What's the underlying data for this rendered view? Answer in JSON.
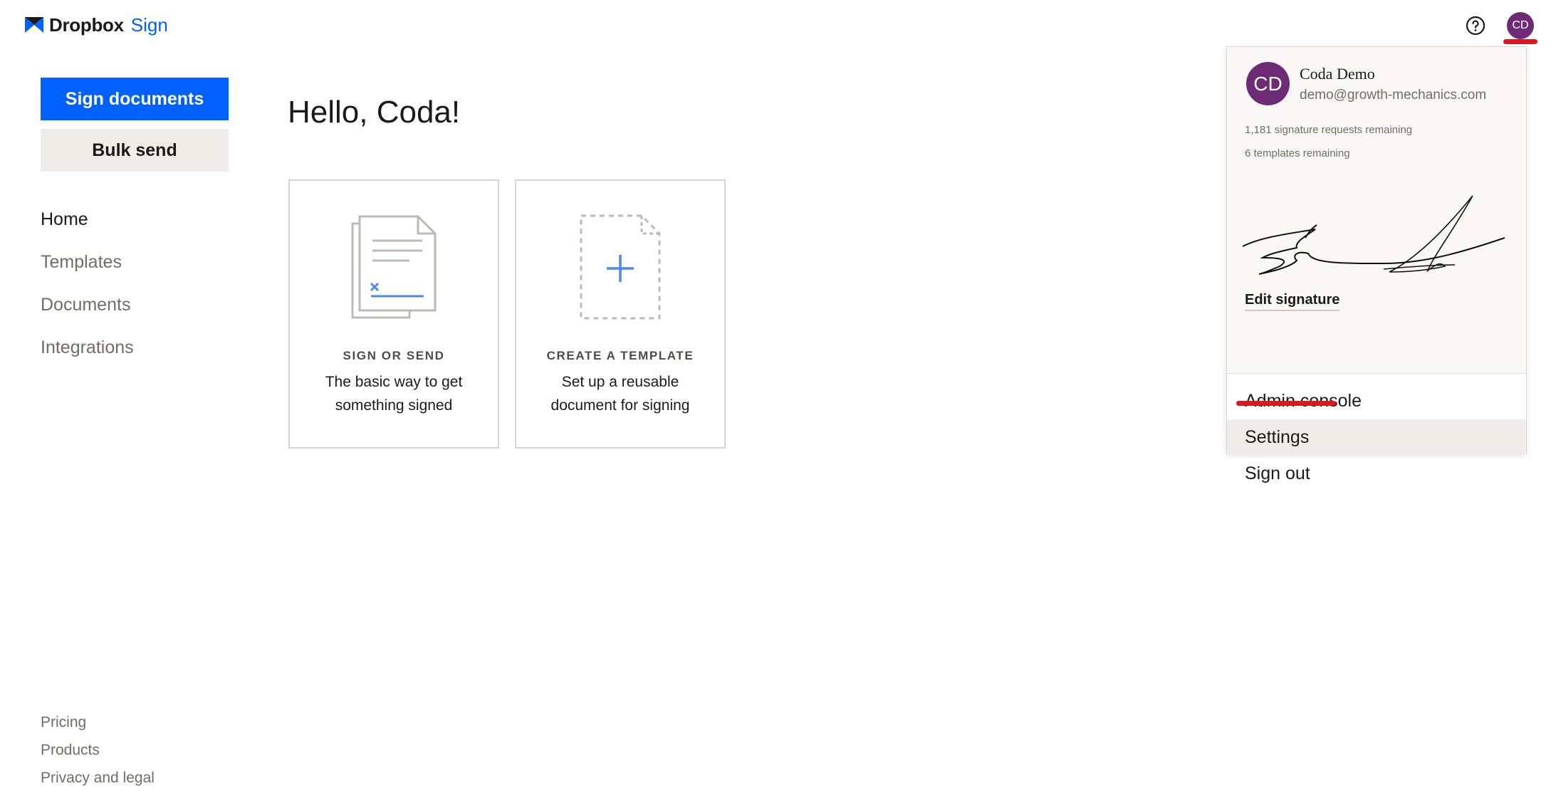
{
  "header": {
    "brand_name": "Dropbox",
    "brand_product": "Sign",
    "help_icon": "help-circle-icon",
    "avatar_initials": "CD"
  },
  "sidebar": {
    "primary_button": "Sign documents",
    "secondary_button": "Bulk send",
    "nav": [
      {
        "label": "Home",
        "active": true
      },
      {
        "label": "Templates",
        "active": false
      },
      {
        "label": "Documents",
        "active": false
      },
      {
        "label": "Integrations",
        "active": false
      }
    ],
    "footer_links": [
      "Pricing",
      "Products",
      "Privacy and legal"
    ]
  },
  "main": {
    "greeting": "Hello, Coda!",
    "cards": [
      {
        "title": "SIGN OR SEND",
        "description": "The basic way to get something signed",
        "icon": "document-sign-icon"
      },
      {
        "title": "CREATE A TEMPLATE",
        "description": "Set up a reusable document for signing",
        "icon": "new-template-icon"
      }
    ]
  },
  "account_menu": {
    "avatar_initials": "CD",
    "name": "Coda Demo",
    "email": "demo@growth-mechanics.com",
    "signature_requests_remaining": "1,181 signature requests remaining",
    "templates_remaining": "6 templates remaining",
    "edit_signature": "Edit signature",
    "items": [
      "Admin console",
      "Settings",
      "Sign out"
    ],
    "highlighted_item": "Settings"
  },
  "colors": {
    "accent": "#0061fe",
    "avatar": "#6d2a75",
    "annotation": "#e3141c",
    "secondary_bg": "#f0ede8"
  }
}
